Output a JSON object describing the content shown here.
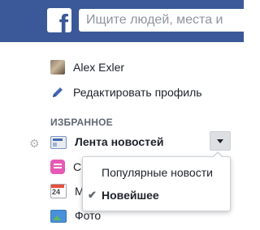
{
  "topbar": {
    "logo_letter": "f",
    "search_placeholder": "Ищите людей, места и"
  },
  "menu": {
    "user_name": "Alex Exler",
    "edit_profile": "Редактировать профиль",
    "section_favorites": "ИЗБРАННОЕ",
    "news_feed": "Лента новостей",
    "messages_partial": "С",
    "events_partial": "М",
    "calendar_day": "24",
    "photos": "Фото"
  },
  "dropdown": {
    "items": [
      {
        "label": "Популярные новости",
        "checked": false
      },
      {
        "label": "Новейшее",
        "checked": true
      }
    ],
    "check_glyph": "✔"
  },
  "colors": {
    "brand": "#3b5998",
    "accent": "#4267b2"
  }
}
